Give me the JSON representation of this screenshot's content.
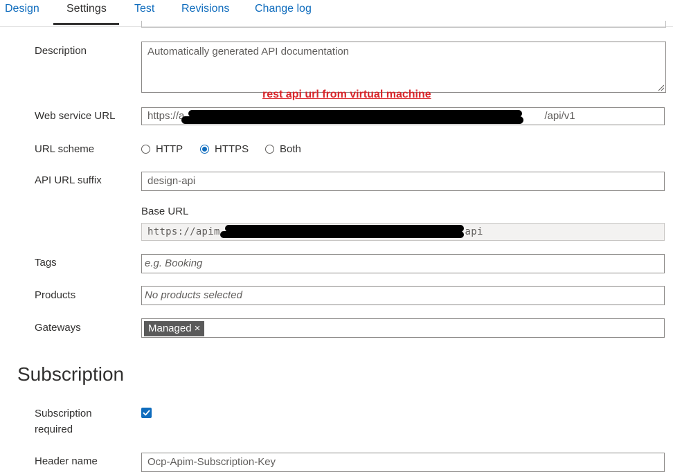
{
  "tabs": [
    {
      "label": "Design"
    },
    {
      "label": "Settings"
    },
    {
      "label": "Test"
    },
    {
      "label": "Revisions"
    },
    {
      "label": "Change log"
    }
  ],
  "active_tab": "Settings",
  "annotation": "rest api url from virtual machine",
  "fields": {
    "description": {
      "label": "Description",
      "value": "Automatically generated API documentation"
    },
    "web_service_url": {
      "label": "Web service URL",
      "value_prefix": "https://a",
      "value_suffix": "/api/v1"
    },
    "url_scheme": {
      "label": "URL scheme",
      "options": [
        "HTTP",
        "HTTPS",
        "Both"
      ],
      "selected": "HTTPS"
    },
    "api_url_suffix": {
      "label": "API URL suffix",
      "value": "design-api"
    },
    "base_url": {
      "label": "Base URL",
      "value_prefix": "https://apim-",
      "value_suffix": "api"
    },
    "tags": {
      "label": "Tags",
      "placeholder": "e.g. Booking"
    },
    "products": {
      "label": "Products",
      "placeholder": "No products selected"
    },
    "gateways": {
      "label": "Gateways",
      "chip": "Managed",
      "chip_remove": "×"
    }
  },
  "subscription": {
    "title": "Subscription",
    "required_label_line1": "Subscription",
    "required_label_line2": "required",
    "required_checked": true,
    "header_name_label": "Header name",
    "header_name_value": "Ocp-Apim-Subscription-Key"
  },
  "colors": {
    "link": "#0f6cbd",
    "annotation": "#d9262b",
    "redaction": "#000000"
  }
}
